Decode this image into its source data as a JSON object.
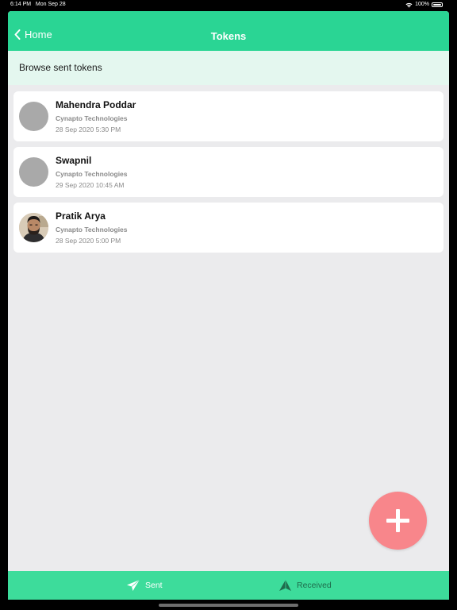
{
  "status_bar": {
    "time": "6:14 PM",
    "date": "Mon Sep 28",
    "battery": "100%"
  },
  "nav": {
    "back_label": "Home",
    "title": "Tokens"
  },
  "subheader": "Browse sent tokens",
  "tokens": [
    {
      "name": "Mahendra Poddar",
      "company": "Cynapto Technologies",
      "datetime": "28 Sep 2020  5:30 PM",
      "avatar": "placeholder"
    },
    {
      "name": "Swapnil",
      "company": "Cynapto Technologies",
      "datetime": "29 Sep 2020  10:45 AM",
      "avatar": "placeholder"
    },
    {
      "name": "Pratik Arya",
      "company": "Cynapto Technologies",
      "datetime": "28 Sep 2020  5:00 PM",
      "avatar": "photo"
    }
  ],
  "tabs": [
    {
      "label": "Sent",
      "icon": "paper-plane-icon",
      "active": true
    },
    {
      "label": "Received",
      "icon": "received-arrow-icon",
      "active": false
    }
  ],
  "colors": {
    "nav": "#2ad594",
    "subheader_bg": "#e4f7ef",
    "tab_bar": "#3ddc9b",
    "fab": "#f8868b",
    "avatar_placeholder": "#a9a9a9"
  }
}
